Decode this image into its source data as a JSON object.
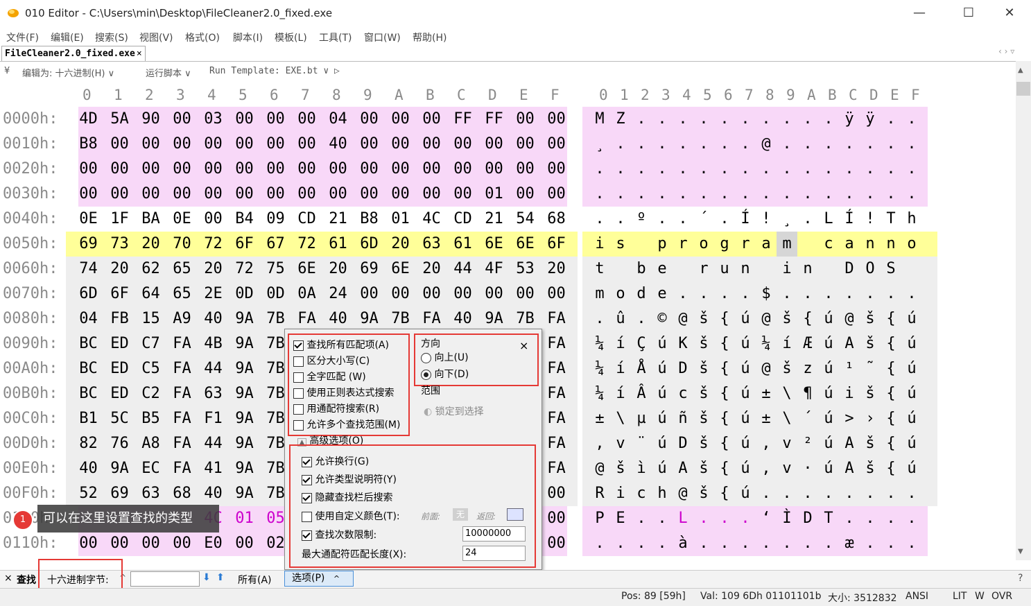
{
  "window": {
    "title": "010 Editor - C:\\Users\\min\\Desktop\\FileCleaner2.0_fixed.exe",
    "minimize": "—",
    "maximize": "☐",
    "close": "✕"
  },
  "menu": [
    "文件(F)",
    "编辑(E)",
    "搜索(S)",
    "视图(V)",
    "格式(O)",
    "脚本(I)",
    "模板(L)",
    "工具(T)",
    "窗口(W)",
    "帮助(H)"
  ],
  "tab": {
    "label": "FileCleaner2.0_fixed.exe",
    "close": "×"
  },
  "tabbar_right": "‹ › ▿",
  "toolbar2": {
    "collapse": "¥",
    "edit_as": "编辑为: 十六进制(H) ∨",
    "run_script": "运行脚本 ∨",
    "run_template": "Run Template: EXE.bt ∨ ▷"
  },
  "hex": {
    "col_headers": [
      "0",
      "1",
      "2",
      "3",
      "4",
      "5",
      "6",
      "7",
      "8",
      "9",
      "A",
      "B",
      "C",
      "D",
      "E",
      "F"
    ],
    "rows": [
      {
        "addr": "0000h:",
        "bytes": [
          "4D",
          "5A",
          "90",
          "00",
          "03",
          "00",
          "00",
          "00",
          "04",
          "00",
          "00",
          "00",
          "FF",
          "FF",
          "00",
          "00"
        ],
        "chars": [
          "M",
          "Z",
          ".",
          ".",
          ".",
          ".",
          ".",
          ".",
          ".",
          ".",
          ".",
          ".",
          "ÿ",
          "ÿ",
          ".",
          "."
        ],
        "bg": "pink"
      },
      {
        "addr": "0010h:",
        "bytes": [
          "B8",
          "00",
          "00",
          "00",
          "00",
          "00",
          "00",
          "00",
          "40",
          "00",
          "00",
          "00",
          "00",
          "00",
          "00",
          "00"
        ],
        "chars": [
          "¸",
          ".",
          ".",
          ".",
          ".",
          ".",
          ".",
          ".",
          "@",
          ".",
          ".",
          ".",
          ".",
          ".",
          ".",
          "."
        ],
        "bg": "pink"
      },
      {
        "addr": "0020h:",
        "bytes": [
          "00",
          "00",
          "00",
          "00",
          "00",
          "00",
          "00",
          "00",
          "00",
          "00",
          "00",
          "00",
          "00",
          "00",
          "00",
          "00"
        ],
        "chars": [
          ".",
          ".",
          ".",
          ".",
          ".",
          ".",
          ".",
          ".",
          ".",
          ".",
          ".",
          ".",
          ".",
          ".",
          ".",
          "."
        ],
        "bg": "pink"
      },
      {
        "addr": "0030h:",
        "bytes": [
          "00",
          "00",
          "00",
          "00",
          "00",
          "00",
          "00",
          "00",
          "00",
          "00",
          "00",
          "00",
          "00",
          "01",
          "00",
          "00"
        ],
        "chars": [
          ".",
          ".",
          ".",
          ".",
          ".",
          ".",
          ".",
          ".",
          ".",
          ".",
          ".",
          ".",
          ".",
          ".",
          ".",
          "."
        ],
        "bg": "pink"
      },
      {
        "addr": "0040h:",
        "bytes": [
          "0E",
          "1F",
          "BA",
          "0E",
          "00",
          "B4",
          "09",
          "CD",
          "21",
          "B8",
          "01",
          "4C",
          "CD",
          "21",
          "54",
          "68"
        ],
        "chars": [
          ".",
          ".",
          "º",
          ".",
          ".",
          "´",
          ".",
          "Í",
          "!",
          "¸",
          ".",
          "L",
          "Í",
          "!",
          "T",
          "h"
        ],
        "bg": "none"
      },
      {
        "addr": "0050h:",
        "bytes": [
          "69",
          "73",
          "20",
          "70",
          "72",
          "6F",
          "67",
          "72",
          "61",
          "6D",
          "20",
          "63",
          "61",
          "6E",
          "6E",
          "6F"
        ],
        "chars": [
          "i",
          "s",
          " ",
          "p",
          "r",
          "o",
          "g",
          "r",
          "a",
          "m",
          " ",
          "c",
          "a",
          "n",
          "n",
          "o"
        ],
        "bg": "yellow"
      },
      {
        "addr": "0060h:",
        "bytes": [
          "74",
          "20",
          "62",
          "65",
          "20",
          "72",
          "75",
          "6E",
          "20",
          "69",
          "6E",
          "20",
          "44",
          "4F",
          "53",
          "20"
        ],
        "chars": [
          "t",
          " ",
          "b",
          "e",
          " ",
          "r",
          "u",
          "n",
          " ",
          "i",
          "n",
          " ",
          "D",
          "O",
          "S",
          " "
        ],
        "bg": "gray"
      },
      {
        "addr": "0070h:",
        "bytes": [
          "6D",
          "6F",
          "64",
          "65",
          "2E",
          "0D",
          "0D",
          "0A",
          "24",
          "00",
          "00",
          "00",
          "00",
          "00",
          "00",
          "00"
        ],
        "chars": [
          "m",
          "o",
          "d",
          "e",
          ".",
          ".",
          ".",
          ".",
          "$",
          ".",
          ".",
          ".",
          ".",
          ".",
          ".",
          "."
        ],
        "bg": "gray"
      },
      {
        "addr": "0080h:",
        "bytes": [
          "04",
          "FB",
          "15",
          "A9",
          "40",
          "9A",
          "7B",
          "FA",
          "40",
          "9A",
          "7B",
          "FA",
          "40",
          "9A",
          "7B",
          "FA"
        ],
        "chars": [
          ".",
          "û",
          ".",
          "©",
          "@",
          "š",
          "{",
          "ú",
          "@",
          "š",
          "{",
          "ú",
          "@",
          "š",
          "{",
          "ú"
        ],
        "bg": "gray"
      },
      {
        "addr": "0090h:",
        "bytes": [
          "BC",
          "ED",
          "C7",
          "FA",
          "4B",
          "9A",
          "7B",
          "",
          "",
          "",
          "",
          "",
          "",
          "",
          "",
          "FA"
        ],
        "chars": [
          "¼",
          "í",
          "Ç",
          "ú",
          "K",
          "š",
          "{",
          "ú",
          "¼",
          "í",
          "Æ",
          "ú",
          "A",
          "š",
          "{",
          "ú"
        ],
        "bg": "gray"
      },
      {
        "addr": "00A0h:",
        "bytes": [
          "BC",
          "ED",
          "C5",
          "FA",
          "44",
          "9A",
          "7B",
          "",
          "",
          "",
          "",
          "",
          "",
          "",
          "",
          "FA"
        ],
        "chars": [
          "¼",
          "í",
          "Å",
          "ú",
          "D",
          "š",
          "{",
          "ú",
          "@",
          "š",
          "z",
          "ú",
          "¹",
          "˜",
          "{",
          "ú"
        ],
        "bg": "gray"
      },
      {
        "addr": "00B0h:",
        "bytes": [
          "BC",
          "ED",
          "C2",
          "FA",
          "63",
          "9A",
          "7B",
          "",
          "",
          "",
          "",
          "",
          "",
          "",
          "",
          "FA"
        ],
        "chars": [
          "¼",
          "í",
          "Â",
          "ú",
          "c",
          "š",
          "{",
          "ú",
          "±",
          "\\",
          "¶",
          "ú",
          "i",
          "š",
          "{",
          "ú"
        ],
        "bg": "gray"
      },
      {
        "addr": "00C0h:",
        "bytes": [
          "B1",
          "5C",
          "B5",
          "FA",
          "F1",
          "9A",
          "7B",
          "",
          "",
          "",
          "",
          "",
          "",
          "",
          "",
          "FA"
        ],
        "chars": [
          "±",
          "\\",
          "µ",
          "ú",
          "ñ",
          "š",
          "{",
          "ú",
          "±",
          "\\",
          "´",
          "ú",
          ">",
          "›",
          "{",
          "ú"
        ],
        "bg": "gray"
      },
      {
        "addr": "00D0h:",
        "bytes": [
          "82",
          "76",
          "A8",
          "FA",
          "44",
          "9A",
          "7B",
          "",
          "",
          "",
          "",
          "",
          "",
          "",
          "",
          "FA"
        ],
        "chars": [
          "‚",
          "v",
          "¨",
          "ú",
          "D",
          "š",
          "{",
          "ú",
          "‚",
          "v",
          "²",
          "ú",
          "A",
          "š",
          "{",
          "ú"
        ],
        "bg": "gray"
      },
      {
        "addr": "00E0h:",
        "bytes": [
          "40",
          "9A",
          "EC",
          "FA",
          "41",
          "9A",
          "7B",
          "",
          "",
          "",
          "",
          "",
          "",
          "",
          "",
          "FA"
        ],
        "chars": [
          "@",
          "š",
          "ì",
          "ú",
          "A",
          "š",
          "{",
          "ú",
          "‚",
          "v",
          "·",
          "ú",
          "A",
          "š",
          "{",
          "ú"
        ],
        "bg": "gray"
      },
      {
        "addr": "00F0h:",
        "bytes": [
          "52",
          "69",
          "63",
          "68",
          "40",
          "9A",
          "7B",
          "",
          "",
          "",
          "",
          "",
          "",
          "",
          "",
          "00"
        ],
        "chars": [
          "R",
          "i",
          "c",
          "h",
          "@",
          "š",
          "{",
          "ú",
          ".",
          ".",
          ".",
          ".",
          ".",
          ".",
          ".",
          "."
        ],
        "bg": "gray"
      },
      {
        "addr": "0100h:",
        "bytes": [
          "",
          "",
          "",
          "",
          "4C",
          "01",
          "05",
          "",
          "",
          "",
          "",
          "",
          "",
          "",
          "",
          "00"
        ],
        "chars": [
          "P",
          "E",
          ".",
          ".",
          "L",
          ".",
          ".",
          ".",
          "‘",
          "Ì",
          "D",
          "T",
          ".",
          ".",
          ".",
          "."
        ],
        "bg": "pink"
      },
      {
        "addr": "0110h:",
        "bytes": [
          "00",
          "00",
          "00",
          "00",
          "E0",
          "00",
          "02",
          "",
          "",
          "",
          "",
          "",
          "",
          "",
          "",
          "00"
        ],
        "chars": [
          ".",
          ".",
          ".",
          ".",
          "à",
          ".",
          ".",
          ".",
          ".",
          ".",
          ".",
          ".",
          "æ",
          ".",
          ".",
          "."
        ],
        "bg": "pink"
      }
    ]
  },
  "tooltip": {
    "badge": "1",
    "text": "可以在这里设置查找的类型"
  },
  "findbar": {
    "close": "×",
    "label": "查找",
    "type": "十六进制字节:",
    "type_caret": "^",
    "search_value": "",
    "down": "⬇",
    "up": "⬆",
    "all": "所有(A)",
    "options": "选项(P)",
    "options_caret": "^",
    "help": "?"
  },
  "popup": {
    "close": "×",
    "left_options": [
      {
        "label": "查找所有匹配项(A)",
        "checked": true
      },
      {
        "label": "区分大小写(C)",
        "checked": false
      },
      {
        "label": "全字匹配 (W)",
        "checked": false
      },
      {
        "label": "使用正则表达式搜索",
        "checked": false
      },
      {
        "label": "用通配符搜索(R)",
        "checked": false
      },
      {
        "label": "允许多个查找范围(M)",
        "checked": false
      }
    ],
    "direction_title": "方向",
    "dir_up": "向上(U)",
    "dir_down": "向下(D)",
    "range_title": "范围",
    "lock_selection": "锁定到选择",
    "advanced_toggle": "▲",
    "advanced_title": "高级选项(O)",
    "adv_options": [
      {
        "label": "允许换行(G)",
        "checked": true
      },
      {
        "label": "允许类型说明符(Y)",
        "checked": true
      },
      {
        "label": "隐藏查找栏后搜索",
        "checked": true
      },
      {
        "label": "使用自定义颜色(T):",
        "checked": false
      },
      {
        "label": "查找次数限制:",
        "checked": true
      }
    ],
    "color_fg_label": "前面:",
    "color_fg_value": "无",
    "color_bg_label": "返回:",
    "limit_value": "10000000",
    "max_wildcard_label": "最大通配符匹配长度(X):",
    "max_wildcard_value": "24"
  },
  "status": {
    "pos": "Pos: 89 [59h]",
    "val": "Val: 109 6Dh 01101101b",
    "size": "大小: 3512832",
    "enc": "ANSI",
    "lit": "LIT",
    "w": "W",
    "ovr": "OVR"
  },
  "colors": {
    "pink": "#f8d8f8",
    "yellow": "#ffff99",
    "gray": "#eeeeee",
    "accent": "#e53935",
    "magenta": "#cc00cc"
  }
}
